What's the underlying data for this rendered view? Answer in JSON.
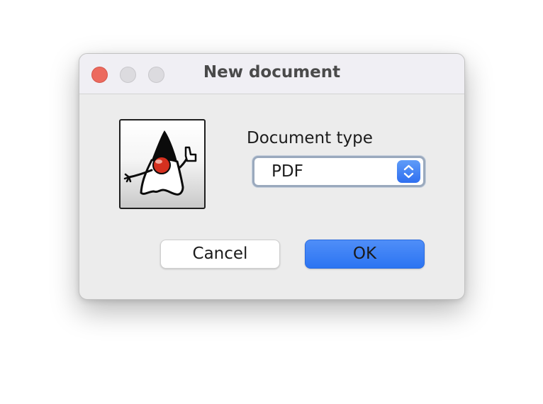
{
  "window": {
    "title": "New document"
  },
  "logo": {
    "icon": "java-duke-icon"
  },
  "document_type": {
    "label": "Document type",
    "selected": "PDF",
    "control_icon": "up-down-chevron-icon"
  },
  "buttons": {
    "cancel_label": "Cancel",
    "ok_label": "OK"
  },
  "colors": {
    "close": "#ec6a5e",
    "accent": "#3a7ff5",
    "window_bg": "#ececec"
  }
}
